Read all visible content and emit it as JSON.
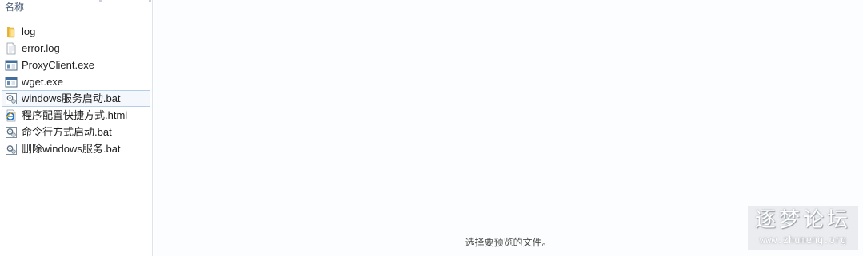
{
  "file_pane": {
    "column_header": "名称",
    "files": [
      {
        "name": "log",
        "icon": "folder-icon"
      },
      {
        "name": "error.log",
        "icon": "text-file-icon"
      },
      {
        "name": "ProxyClient.exe",
        "icon": "exe-icon"
      },
      {
        "name": "wget.exe",
        "icon": "exe-icon"
      },
      {
        "name": "windows服务启动.bat",
        "icon": "bat-file-icon",
        "selected": true
      },
      {
        "name": "程序配置快捷方式.html",
        "icon": "ie-html-icon"
      },
      {
        "name": "命令行方式启动.bat",
        "icon": "bat-file-icon"
      },
      {
        "name": "删除windows服务.bat",
        "icon": "bat-file-icon"
      }
    ]
  },
  "preview_pane": {
    "message": "选择要预览的文件。"
  },
  "watermark": {
    "title": "逐梦论坛",
    "url": "www.zhumeng.org"
  }
}
